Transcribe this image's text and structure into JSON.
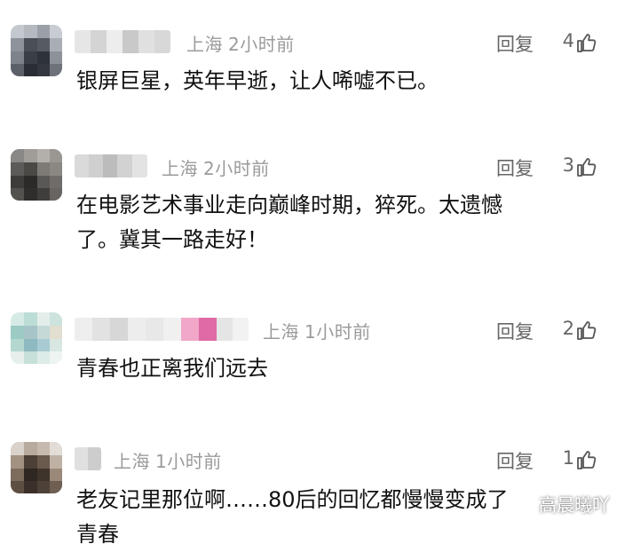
{
  "comments": [
    {
      "location": "上海",
      "time": "2小时前",
      "reply_label": "回复",
      "likes": "4",
      "lines": [
        "银屏巨星，英年早逝，让人唏嘘不已。"
      ]
    },
    {
      "location": "上海",
      "time": "2小时前",
      "reply_label": "回复",
      "likes": "3",
      "lines": [
        "在电影艺术事业走向巅峰时期，猝死。太遗憾",
        "了。冀其一路走好！"
      ]
    },
    {
      "location": "上海",
      "time": "1小时前",
      "reply_label": "回复",
      "likes": "2",
      "lines": [
        "青春也正离我们远去"
      ]
    },
    {
      "location": "上海",
      "time": "1小时前",
      "reply_label": "回复",
      "likes": "1",
      "lines": [
        "老友记里那位啊……80后的回忆都慢慢变成了",
        "青春"
      ]
    }
  ],
  "watermark": "高晨曦吖",
  "icons": {
    "like": "thumbs-up-icon"
  },
  "colors": {
    "meta_text": "#9b9b9b",
    "body_text": "#111111"
  }
}
